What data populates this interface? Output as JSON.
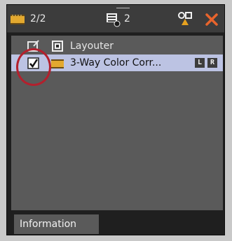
{
  "toolbar": {
    "count": "2/2",
    "stack_count": "2",
    "icons": [
      "clip-icon",
      "filter-stack-icon",
      "shape-tool-icon",
      "close-icon"
    ]
  },
  "tree": {
    "rows": [
      {
        "label": "Layouter",
        "checked": false,
        "icon": "layouter-icon"
      },
      {
        "label": "3-Way Color Corr...",
        "checked": true,
        "icon": "clip-icon",
        "badges": [
          "L",
          "R"
        ]
      }
    ]
  },
  "tabs": {
    "information": "Information"
  },
  "colors": {
    "toolbar": "#3c3c3c",
    "content": "#5a5a5a",
    "selected_row": "#bcc3e3",
    "close": "#e8642c",
    "highlight_circle": "#b3202d"
  }
}
